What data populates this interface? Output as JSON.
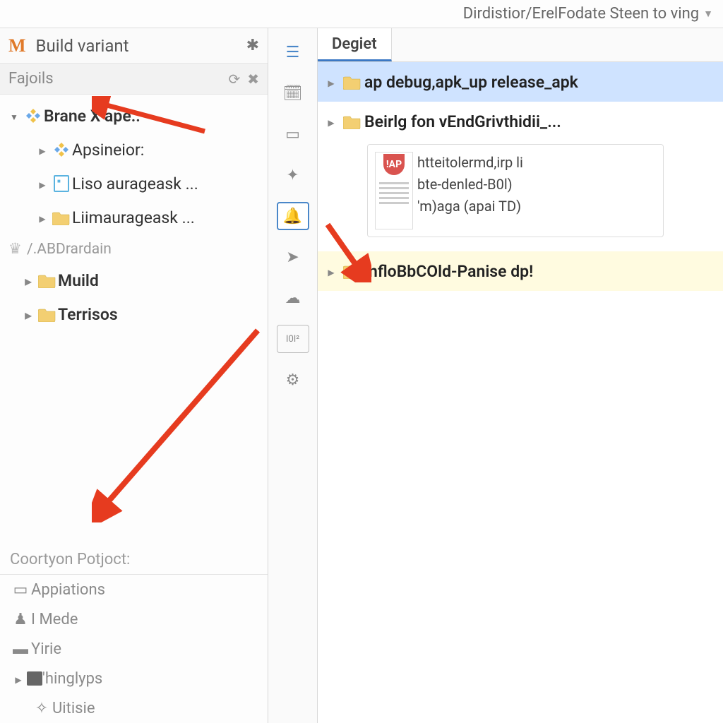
{
  "window": {
    "breadcrumb": "Dirdistior/ErelFodate Steen to ving"
  },
  "sidebar": {
    "title": "Build variant",
    "subtitle": "Fajoils",
    "tree": {
      "root": "Brane X ape..",
      "child0": "Apsineior:",
      "child1": "Liso aurageask ...",
      "child2": "Liimaurageask ..."
    },
    "section": "/.ABDrardain",
    "muild": "Muild",
    "terrisos": "Terrisos"
  },
  "footer": {
    "heading": "Coortyon Potjoct:",
    "items": [
      "Appiations",
      "I Mede",
      "Yirie",
      "'hinglyps",
      "Uitisie"
    ]
  },
  "tabs": {
    "active": "Degiet"
  },
  "files": {
    "row0": "ap debug,apk_up release_apk",
    "row1": "Beirlg fon vEndGrivthidii_...",
    "row2": "infloBbCOld-Panise dp!"
  },
  "doc": {
    "badge": "!AP",
    "line1": "htteitolermd,irp li",
    "line2": "bte-denled-B0l)",
    "line3": "'m)aga (apai TD)"
  }
}
